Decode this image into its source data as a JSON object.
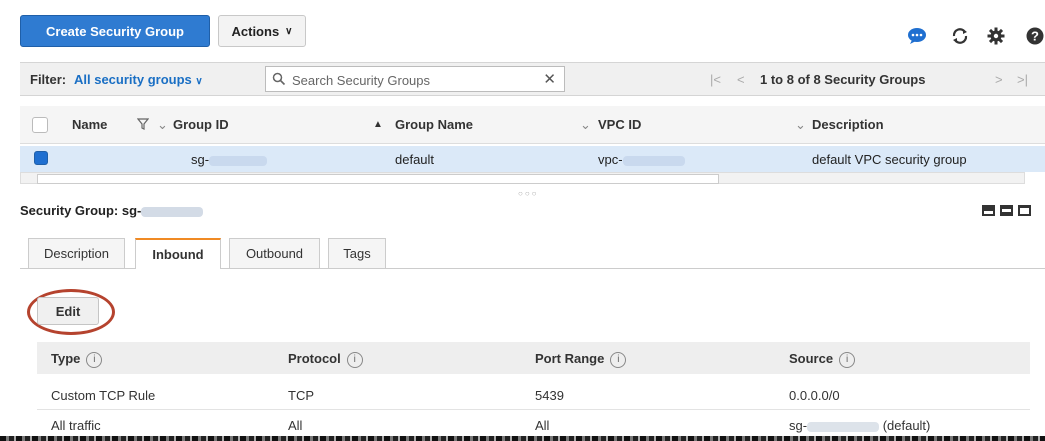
{
  "toolbar": {
    "create_label": "Create Security Group",
    "actions_label": "Actions",
    "icons": [
      "chat-icon",
      "refresh-icon",
      "settings-icon",
      "help-icon"
    ]
  },
  "filterbar": {
    "filter_label": "Filter:",
    "filter_value": "All security groups",
    "search_placeholder": "Search Security Groups",
    "pager_text": "1 to 8 of 8 Security Groups"
  },
  "table": {
    "columns": [
      "Name",
      "Group ID",
      "Group Name",
      "VPC ID",
      "Description"
    ],
    "selected_row": {
      "group_id_prefix": "sg-",
      "group_name": "default",
      "vpc_prefix": "vpc-",
      "description": "default VPC security group"
    }
  },
  "detail": {
    "title_prefix": "Security Group: sg-",
    "tabs": [
      "Description",
      "Inbound",
      "Outbound",
      "Tags"
    ],
    "active_tab": "Inbound",
    "edit_label": "Edit",
    "rules_columns": [
      "Type",
      "Protocol",
      "Port Range",
      "Source"
    ],
    "info_glyph": "i",
    "rules": [
      {
        "type": "Custom TCP Rule",
        "protocol": "TCP",
        "port_range": "5439",
        "source": "0.0.0.0/0"
      },
      {
        "type": "All traffic",
        "protocol": "All",
        "port_range": "All",
        "source_prefix": "sg-",
        "source_suffix": "(default)"
      }
    ]
  },
  "colors": {
    "primary": "#2f7bd1",
    "link": "#1a6fc4",
    "selected_row": "#dbe9f8",
    "tab_accent": "#f08a24",
    "highlight_ring": "#b5432e"
  }
}
